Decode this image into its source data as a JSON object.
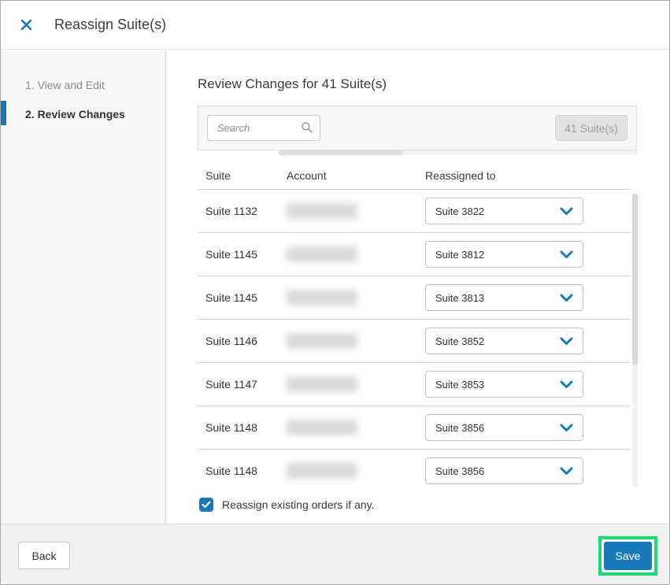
{
  "modal": {
    "title": "Reassign Suite(s)"
  },
  "steps": [
    {
      "label": "1. View and Edit",
      "active": false
    },
    {
      "label": "2. Review Changes",
      "active": true
    }
  ],
  "content": {
    "heading": "Review Changes for 41 Suite(s)",
    "search_placeholder": "Search",
    "suites_count_button": "41 Suite(s)",
    "table": {
      "columns": [
        "Suite",
        "Account",
        "Reassigned to"
      ],
      "rows": [
        {
          "suite": "Suite 1132",
          "account": "[redacted]",
          "reassigned_to": "Suite 3822"
        },
        {
          "suite": "Suite 1145",
          "account": "[redacted]",
          "reassigned_to": "Suite 3812"
        },
        {
          "suite": "Suite 1145",
          "account": "[redacted]",
          "reassigned_to": "Suite 3813"
        },
        {
          "suite": "Suite 1146",
          "account": "[redacted]",
          "reassigned_to": "Suite 3852"
        },
        {
          "suite": "Suite 1147",
          "account": "[redacted]",
          "reassigned_to": "Suite 3853"
        },
        {
          "suite": "Suite 1148",
          "account": "[redacted]",
          "reassigned_to": "Suite 3856"
        },
        {
          "suite": "Suite 1148",
          "account": "[redacted]",
          "reassigned_to": "Suite 3856"
        }
      ]
    },
    "checkbox": {
      "label": "Reassign existing orders if any.",
      "checked": true
    }
  },
  "footer": {
    "back_label": "Back",
    "save_label": "Save"
  },
  "icons": {
    "close": "x-cross",
    "search": "magnifier",
    "chevron": "chevron-down",
    "check": "checkmark"
  },
  "colors": {
    "primary_blue": "#1779ba",
    "highlight_green": "#16df79",
    "sidebar_bg": "#f6f6f6",
    "footer_bg": "#f1f1f1"
  }
}
